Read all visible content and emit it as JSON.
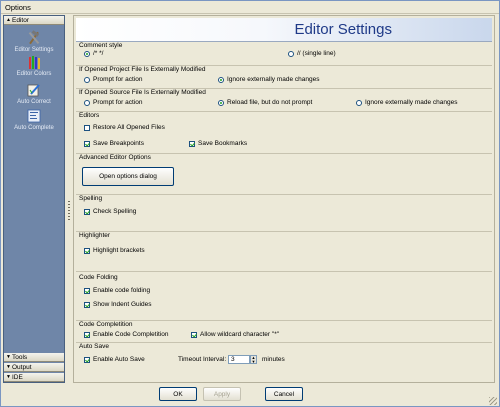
{
  "window": {
    "title": "Options"
  },
  "sidebar": {
    "top_tab": "Editor",
    "items": [
      {
        "label": "Editor Settings",
        "icon": "tools-icon"
      },
      {
        "label": "Editor Colors",
        "icon": "pencils-icon"
      },
      {
        "label": "Auto Correct",
        "icon": "autocorrect-icon"
      },
      {
        "label": "Auto Complete",
        "icon": "autocomplete-icon"
      }
    ],
    "bottom_tabs": [
      "Tools",
      "Output",
      "IDE"
    ]
  },
  "page": {
    "title": "Editor Settings"
  },
  "comment_style": {
    "title": "Comment style",
    "options": [
      "/* */",
      "// (single line)"
    ],
    "selected": 0
  },
  "project_modified": {
    "title": "If Opened Project File Is Externally Modified",
    "options": [
      "Prompt for action",
      "Ignore externally made changes"
    ],
    "selected": 1
  },
  "source_modified": {
    "title": "If Opened Source File Is Externally Modified",
    "options": [
      "Prompt for action",
      "Reload file, but do not prompt",
      "Ignore externally made changes"
    ],
    "selected": 1
  },
  "editors": {
    "title": "Editors",
    "restore": {
      "label": "Restore All Opened Files",
      "checked": false
    },
    "breakpoints": {
      "label": "Save Breakpoints",
      "checked": true
    },
    "bookmarks": {
      "label": "Save Bookmarks",
      "checked": true
    }
  },
  "advanced": {
    "title": "Advanced Editor Options",
    "button": "Open options dialog"
  },
  "spelling": {
    "title": "Spelling",
    "check": {
      "label": "Check Spelling",
      "checked": true
    }
  },
  "highlighter": {
    "title": "Highlighter",
    "check": {
      "label": "Highlight brackets",
      "checked": true
    }
  },
  "folding": {
    "title": "Code Folding",
    "enable": {
      "label": "Enable code folding",
      "checked": true
    },
    "guides": {
      "label": "Show Indent Guides",
      "checked": true
    }
  },
  "completion": {
    "title": "Code Completition",
    "enable": {
      "label": "Enable Code Completition",
      "checked": true
    },
    "wildcard": {
      "label": "Allow wildcard character \"*\"",
      "checked": true
    }
  },
  "autosave": {
    "title": "Auto Save",
    "enable": {
      "label": "Enable Auto Save",
      "checked": true
    },
    "interval_label": "Timeout Interval:",
    "interval_value": "3",
    "interval_unit": "minutes"
  },
  "footer": {
    "ok": "OK",
    "apply": "Apply",
    "cancel": "Cancel"
  }
}
